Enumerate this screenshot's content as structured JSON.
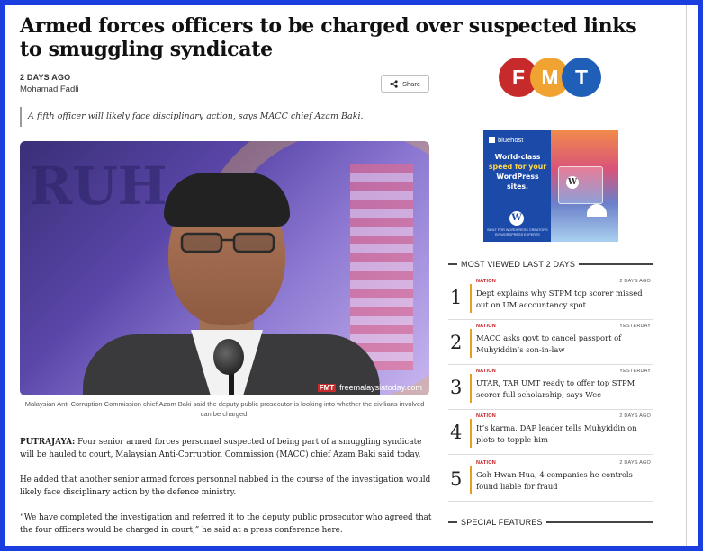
{
  "article": {
    "headline": "Armed forces officers to be charged over suspected links to smuggling syndicate",
    "time_ago": "2 DAYS AGO",
    "author": "Mohamad Fadli",
    "share_label": "Share",
    "standfirst": "A fifth officer will likely face disciplinary action, says MACC chief Azam Baki.",
    "photo_background_text": "RUH",
    "photo_watermark": "freemalaysiatoday.com",
    "photo_watermark_logo": "FMT",
    "caption": "Malaysian Anti-Corruption Commission chief Azam Baki said the deputy public prosecutor is looking into whether the civilians involved can be charged.",
    "paragraphs": [
      {
        "lead": "PUTRAJAYA:",
        "text": " Four senior armed forces personnel suspected of being part of a smuggling syndicate will be hauled to court, Malaysian Anti-Corruption Commission (MACC) chief Azam Baki said today."
      },
      {
        "lead": "",
        "text": "He added that another senior armed forces personnel nabbed in the course of the investigation would likely face disciplinary action by the defence ministry."
      },
      {
        "lead": "",
        "text": "“We have completed the investigation and referred it to the deputy public prosecutor who agreed that the four officers would be charged in court,” he said at a press conference here."
      }
    ]
  },
  "logo": {
    "letters": [
      "F",
      "M",
      "T"
    ],
    "colors": [
      "#c62a2a",
      "#f0a331",
      "#1f5fb8"
    ]
  },
  "ad": {
    "brand": "bluehost",
    "headline_1": "World-class",
    "headline_2": "speed for your",
    "headline_3": "WordPress sites.",
    "footer": "BUILT FOR WORDPRESS CREATORS BY WORDPRESS EXPERTS",
    "wp_glyph": "W"
  },
  "sidebar": {
    "most_viewed_title": "MOST VIEWED LAST 2 DAYS",
    "special_features_title": "SPECIAL FEATURES",
    "accent_color": "#e3a11f",
    "category_color": "#c4161c",
    "items": [
      {
        "rank": "1",
        "category": "NATION",
        "time": "2 DAYS AGO",
        "title": "Dept explains why STPM top scorer missed out on UM accountancy spot"
      },
      {
        "rank": "2",
        "category": "NATION",
        "time": "YESTERDAY",
        "title": "MACC asks govt to cancel passport of Muhyiddin’s son-in-law"
      },
      {
        "rank": "3",
        "category": "NATION",
        "time": "YESTERDAY",
        "title": "UTAR, TAR UMT ready to offer top STPM scorer full scholarship, says Wee"
      },
      {
        "rank": "4",
        "category": "NATION",
        "time": "2 DAYS AGO",
        "title": "It’s karma, DAP leader tells Muhyiddin on plots to topple him"
      },
      {
        "rank": "5",
        "category": "NATION",
        "time": "2 DAYS AGO",
        "title": "Goh Hwan Hua, 4 companies he controls found liable for fraud"
      }
    ]
  },
  "frame_color": "#1a3ee0"
}
